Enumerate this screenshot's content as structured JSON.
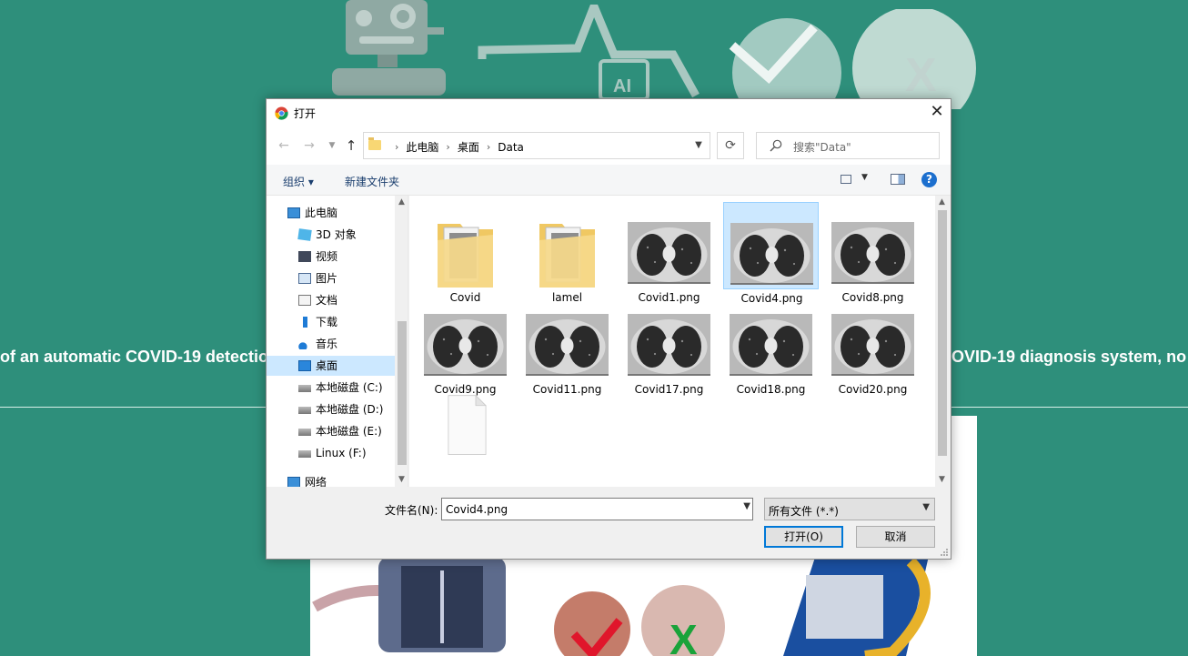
{
  "background": {
    "marquee_left": "of an automatic COVID-19 detectio",
    "marquee_right": "OVID-19 diagnosis system, no",
    "colors": {
      "page": "#2e8f7b",
      "panel": "#ffffff"
    }
  },
  "dialog": {
    "title": "打开",
    "close_icon": "close-icon",
    "breadcrumb": [
      "此电脑",
      "桌面",
      "Data"
    ],
    "search_placeholder": "搜索\"Data\"",
    "toolbar": {
      "organize": "组织 ▾",
      "new_folder": "新建文件夹",
      "help": "?"
    },
    "sidebar": [
      {
        "label": "此电脑",
        "icon": "computer-icon"
      },
      {
        "label": "3D 对象",
        "icon": "3d-objects-icon"
      },
      {
        "label": "视频",
        "icon": "video-icon"
      },
      {
        "label": "图片",
        "icon": "pictures-icon"
      },
      {
        "label": "文档",
        "icon": "documents-icon"
      },
      {
        "label": "下载",
        "icon": "download-icon"
      },
      {
        "label": "音乐",
        "icon": "music-icon"
      },
      {
        "label": "桌面",
        "icon": "desktop-icon",
        "selected": true
      },
      {
        "label": "本地磁盘 (C:)",
        "icon": "drive-icon"
      },
      {
        "label": "本地磁盘 (D:)",
        "icon": "drive-icon"
      },
      {
        "label": "本地磁盘 (E:)",
        "icon": "drive-icon"
      },
      {
        "label": "Linux (F:)",
        "icon": "drive-icon"
      },
      {
        "label": "网络",
        "icon": "network-icon"
      }
    ],
    "files": [
      {
        "name": "Covid",
        "kind": "folder"
      },
      {
        "name": "lamel",
        "kind": "folder"
      },
      {
        "name": "Covid1.png",
        "kind": "image"
      },
      {
        "name": "Covid4.png",
        "kind": "image",
        "selected": true
      },
      {
        "name": "Covid8.png",
        "kind": "image"
      },
      {
        "name": "Covid9.png",
        "kind": "image"
      },
      {
        "name": "Covid11.png",
        "kind": "image"
      },
      {
        "name": "Covid17.png",
        "kind": "image"
      },
      {
        "name": "Covid18.png",
        "kind": "image"
      },
      {
        "name": "Covid20.png",
        "kind": "image"
      },
      {
        "name": "",
        "kind": "blank-file"
      }
    ],
    "filename_label": "文件名(N):",
    "filename_value": "Covid4.png",
    "filetype": "所有文件 (*.*)",
    "open_button": "打开(O)",
    "cancel_button": "取消"
  }
}
